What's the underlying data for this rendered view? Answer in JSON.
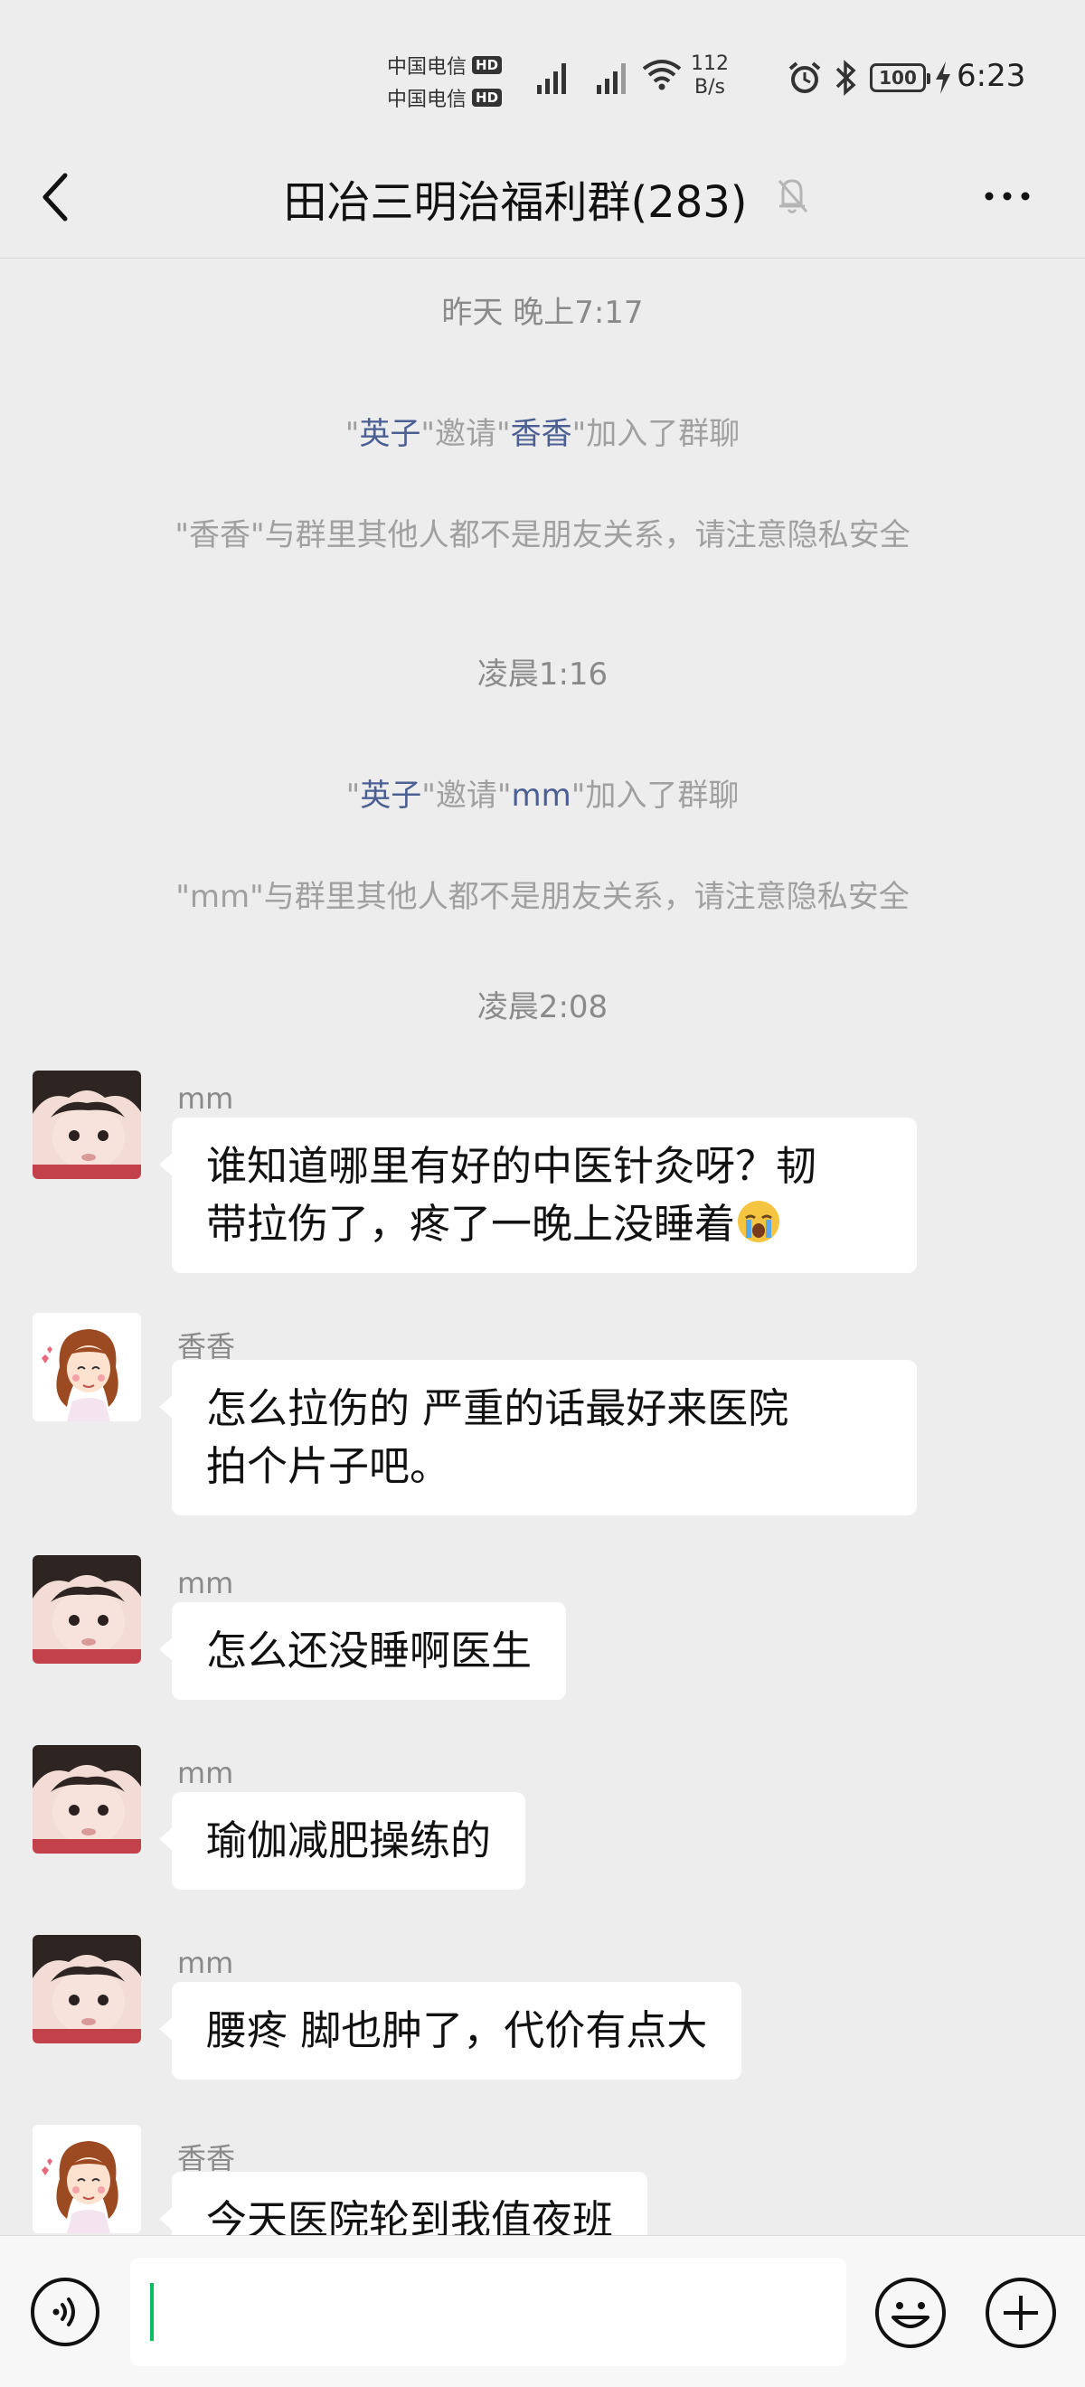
{
  "status_bar": {
    "carrier_1": "中国电信",
    "carrier_2": "中国电信",
    "hd_badge": "HD",
    "net_speed_value": "112",
    "net_speed_unit": "B/s",
    "battery": "100",
    "time": "6:23"
  },
  "nav": {
    "title": "田冶三明治福利群(283)"
  },
  "chat": {
    "events": [
      {
        "time": "昨天 晚上7:17"
      },
      {
        "inviter": "英子",
        "invitee": "香香",
        "prefix_q": "\"",
        "mid_q": "\"邀请\"",
        "suffix": "\"加入了群聊"
      },
      {
        "notice": "\"香香\"与群里其他人都不是朋友关系，请注意隐私安全"
      },
      {
        "time": "凌晨1:16"
      },
      {
        "inviter": "英子",
        "invitee": "mm",
        "prefix_q": "\"",
        "mid_q": "\"邀请\"",
        "suffix": "\"加入了群聊"
      },
      {
        "notice": "\"mm\"与群里其他人都不是朋友关系，请注意隐私安全"
      },
      {
        "time": "凌晨2:08"
      }
    ],
    "messages": [
      {
        "sender": "mm",
        "line1": "谁知道哪里有好的中医针灸呀？韧",
        "line2": "带拉伤了，疼了一晚上没睡着",
        "emoji": "crying-emoji"
      },
      {
        "sender": "香香",
        "line1": "怎么拉伤的  严重的话最好来医院",
        "line2": "拍个片子吧。"
      },
      {
        "sender": "mm",
        "text": "怎么还没睡啊医生"
      },
      {
        "sender": "mm",
        "text": "瑜伽减肥操练的"
      },
      {
        "sender": "mm",
        "text": "腰疼  脚也肿了，代价有点大"
      },
      {
        "sender": "香香",
        "text": "今天医院轮到我值夜班"
      }
    ]
  },
  "colors": {
    "background": "#ededed",
    "highlight_name": "#4c5f93",
    "system_text": "#a0a0a0",
    "caret": "#07c160"
  }
}
